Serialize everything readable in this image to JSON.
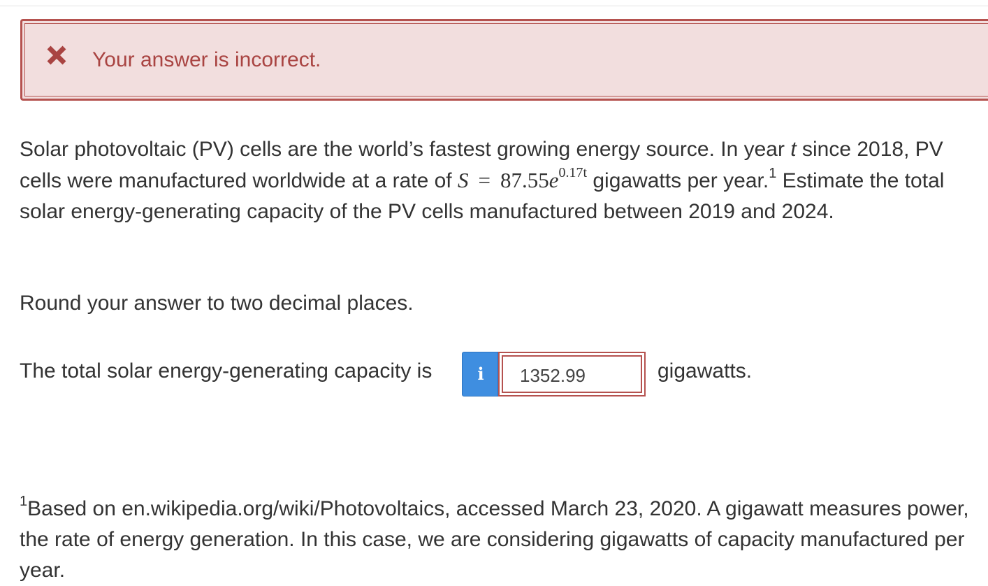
{
  "feedback": {
    "icon": "close-icon",
    "color": "#a94442",
    "background": "#f2dede",
    "message": "Your answer is incorrect."
  },
  "problem": {
    "text_before_var": "Solar photovoltaic (PV) cells are the world’s fastest growing energy source. In year ",
    "var_t": "t",
    "text_mid": " since 2018, PV cells were manufactured worldwide at a rate of ",
    "math_S": "S",
    "math_eq": "=",
    "math_base": "87.55",
    "math_e": "e",
    "math_exp": "0.17t",
    "text_after_math": " gigawatts per year.",
    "footnote_marker": "1",
    "text_end": " Estimate the total solar energy-generating capacity of the PV cells manufactured between 2019 and 2024."
  },
  "instruction": "Round your answer to two decimal places.",
  "answer": {
    "prompt": "The total solar energy-generating capacity is",
    "info_icon": "info-icon",
    "info_glyph": "i",
    "info_color": "#3f8ee0",
    "value": "1352.99",
    "status_color": "#b5524f",
    "unit": "gigawatts."
  },
  "footnote": {
    "marker": "1",
    "text": "Based on en.wikipedia.org/wiki/Photovoltaics, accessed March 23, 2020. A gigawatt measures power, the rate of energy generation. In this case, we are considering gigawatts of capacity manufactured per year."
  }
}
